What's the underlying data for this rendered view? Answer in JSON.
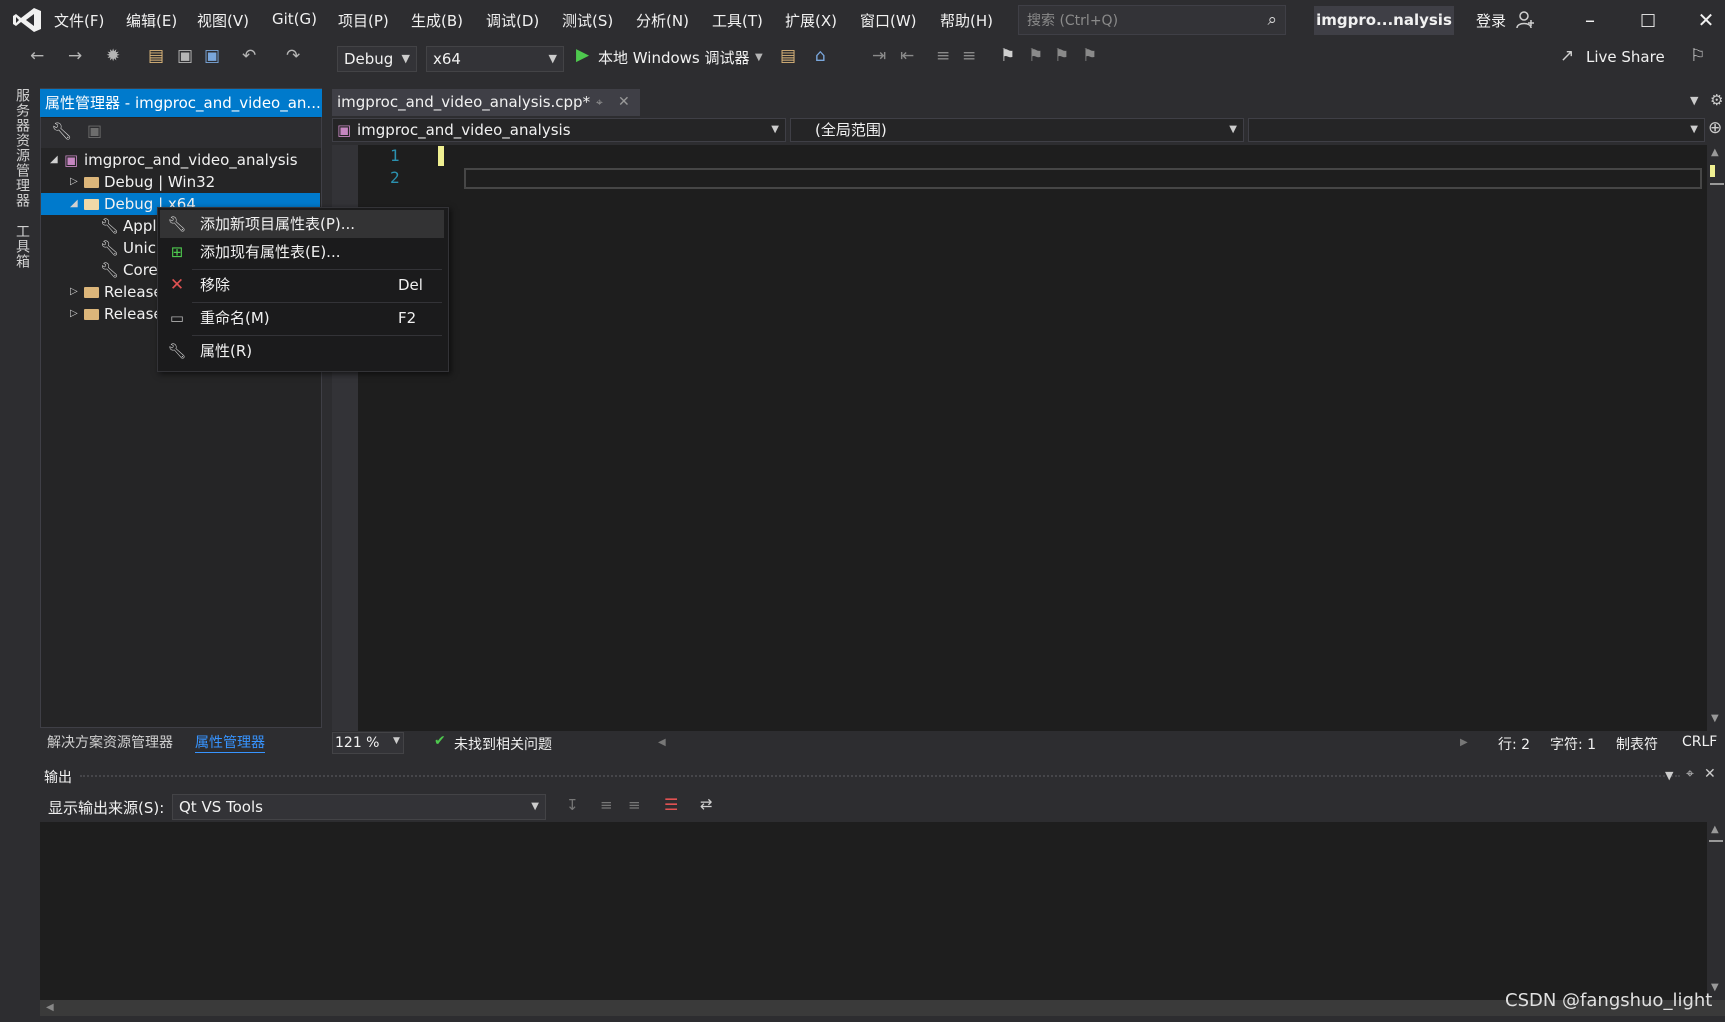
{
  "menubar": {
    "items": [
      "文件(F)",
      "编辑(E)",
      "视图(V)",
      "Git(G)",
      "项目(P)",
      "生成(B)",
      "调试(D)",
      "测试(S)",
      "分析(N)",
      "工具(T)",
      "扩展(X)",
      "窗口(W)",
      "帮助(H)"
    ],
    "search_placeholder": "搜索 (Ctrl+Q)",
    "solution_title": "imgpro...nalysis",
    "signin": "登录"
  },
  "toolbar": {
    "config": "Debug",
    "platform": "x64",
    "debugger": "本地 Windows 调试器",
    "live_share": "Live Share"
  },
  "left_strip": {
    "tabs": [
      "服务器资源管理器",
      "工具箱"
    ]
  },
  "property_manager": {
    "title": "属性管理器 - imgproc_and_video_an...",
    "tree": {
      "root": "imgproc_and_video_analysis",
      "items": [
        "Debug | Win32",
        "Debug | x64",
        "Appl",
        "Unic",
        "Core",
        "Release",
        "Release"
      ]
    },
    "bottom_tabs": [
      "解决方案资源管理器",
      "属性管理器"
    ]
  },
  "editor": {
    "tab_title": "imgproc_and_video_analysis.cpp*",
    "nav_project": "imgproc_and_video_analysis",
    "nav_scope": "(全局范围)",
    "line_numbers": [
      "1",
      "2"
    ]
  },
  "editor_status": {
    "zoom": "121 %",
    "issues": "未找到相关问题",
    "line": "行: 2",
    "char": "字符: 1",
    "tabs": "制表符",
    "eol": "CRLF"
  },
  "context_menu": {
    "items": [
      {
        "label": "添加新项目属性表(P)...",
        "shortcut": ""
      },
      {
        "label": "添加现有属性表(E)...",
        "shortcut": ""
      },
      {
        "label": "移除",
        "shortcut": "Del"
      },
      {
        "label": "重命名(M)",
        "shortcut": "F2"
      },
      {
        "label": "属性(R)",
        "shortcut": ""
      }
    ]
  },
  "output": {
    "title": "输出",
    "source_label": "显示输出来源(S):",
    "source_value": "Qt VS Tools"
  },
  "watermark": "CSDN @fangshuo_light",
  "colors": {
    "accent": "#007acc",
    "background": "#2d2d30",
    "editor": "#1e1e1e"
  }
}
